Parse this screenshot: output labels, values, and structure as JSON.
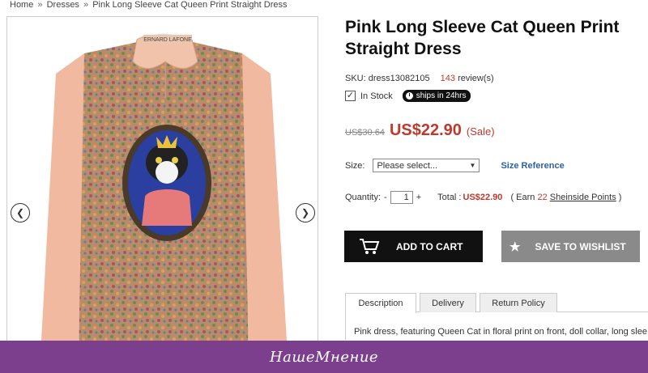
{
  "breadcrumb": {
    "home": "Home",
    "sep": "»",
    "category": "Dresses",
    "current": "Pink Long Sleeve Cat Queen Print Straight Dress"
  },
  "product": {
    "title": "Pink Long Sleeve Cat Queen Print Straight Dress",
    "sku": "SKU: dress13082105",
    "reviews_count": "143",
    "reviews_label": "review(s)",
    "stock": "In Stock",
    "ships": "ships in 24hrs",
    "old_price": "US$30.64",
    "price": "US$22.90",
    "sale": "(Sale)",
    "label_tag": "ERNARD LAFONE"
  },
  "size": {
    "label": "Size:",
    "placeholder": "Please select...",
    "reference": "Size Reference"
  },
  "quantity": {
    "label": "Quantity:",
    "minus": "-",
    "value": "1",
    "plus": "+",
    "total_label": "Total :",
    "total_value": "US$22.90",
    "earn_open": "( Earn",
    "earn_points": "22",
    "earn_link": "Sheinside Points",
    "earn_close": ")"
  },
  "buttons": {
    "add_to_cart": "ADD TO CART",
    "wishlist": "SAVE TO WISHLIST"
  },
  "tabs": [
    "Description",
    "Delivery",
    "Return Policy"
  ],
  "description": "Pink dress, featuring Queen Cat in floral print on front, doll collar, long slee",
  "footer": {
    "logo": "НашеМнение"
  },
  "colors": {
    "price": "#c0392b",
    "footer": "#7b3f8e",
    "link": "#2e5f9e"
  }
}
